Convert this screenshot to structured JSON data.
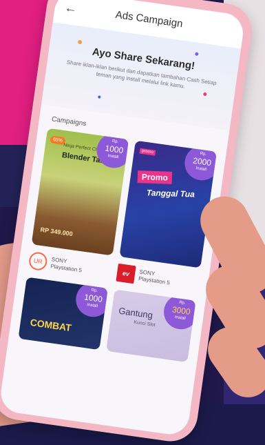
{
  "header": {
    "back_icon": "arrow-left-icon",
    "title": "Ads Campaign"
  },
  "hero": {
    "title": "Ayo Share Sekarang!",
    "subtitle": "Share iklan-iklan berikut dan dapatkan tambahan Cash Setiap teman yang install melalui link kamu."
  },
  "campaigns": {
    "section_title": "Campaigns",
    "cards": [
      {
        "badge_prefix": "Rp.",
        "badge_amount": "1000",
        "badge_suffix": "Install",
        "discount": "65%",
        "subtitle": "Ninja Perfect Chef",
        "title": "Blender Tangan",
        "price": "RP 349.000",
        "brand_logo": "UR",
        "brand_name": "SONY",
        "brand_product": "Playstation 5"
      },
      {
        "badge_prefix": "Rp.",
        "badge_amount": "2000",
        "badge_suffix": "Install",
        "tag": "promo",
        "title": "Promo",
        "title2": "Tanggal Tua",
        "brand_logo": "ev",
        "brand_name": "SONY",
        "brand_product": "Playstation 5"
      },
      {
        "badge_prefix": "Rp.",
        "badge_amount": "1000",
        "badge_suffix": "Install",
        "title": "COMBAT"
      },
      {
        "badge_prefix": "Rp.",
        "badge_amount": "3000",
        "badge_suffix": "Install",
        "title": "Gantung",
        "subtitle": "Kunci Slot"
      }
    ]
  },
  "colors": {
    "accent": "#8d59d9",
    "pink": "#e21f82",
    "phone": "#f4b8c4"
  }
}
